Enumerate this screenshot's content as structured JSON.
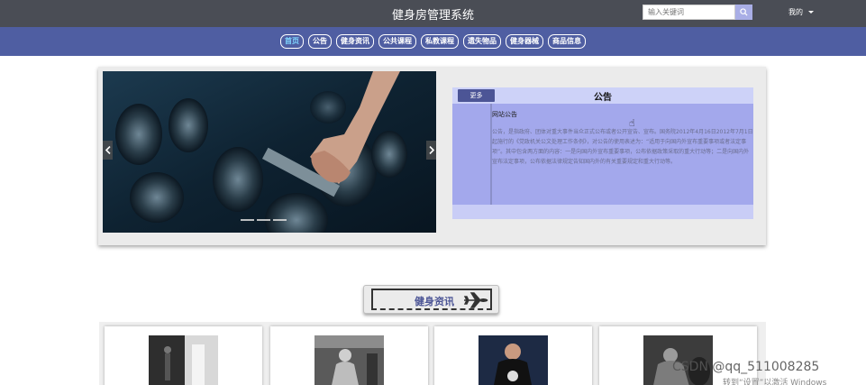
{
  "header": {
    "title": "健身房管理系统",
    "search": {
      "placeholder": "输入关键词",
      "icon": "search-icon"
    },
    "user_label": "我的"
  },
  "nav": {
    "items": [
      {
        "label": "首页",
        "active": true
      },
      {
        "label": "公告",
        "active": false
      },
      {
        "label": "健身资讯",
        "active": false
      },
      {
        "label": "公共课程",
        "active": false
      },
      {
        "label": "私教课程",
        "active": false
      },
      {
        "label": "遗失物品",
        "active": false
      },
      {
        "label": "健身器械",
        "active": false
      },
      {
        "label": "商品信息",
        "active": false
      }
    ]
  },
  "carousel": {
    "prev_icon": "chevron-left-icon",
    "next_icon": "chevron-right-icon",
    "slide_count": 3
  },
  "notice": {
    "more_label": "更多",
    "title": "公告",
    "subtitle": "网站公告",
    "body": "公告，是指政府、团体对重大事件当众正式公布或者公开宣告、宣布。国务院2012年4月16日2012年7月1日起施行的《党政机关公文处理工作条例》，对公告的使用表述为：“适用于向国内外宣布重要事项或者法定事项”。其中包含两方面的内容：一是向国内外宣布重要事项，公布依据政策采取的重大行动等；二是向国内外宣布法定事项，公布依据法律规定告知国内外的有关重要规定和重大行动等。"
  },
  "section": {
    "title": "健身资讯",
    "icon": "airplane-icon"
  },
  "watermark": {
    "text": "CSDN @qq_511008285",
    "subtext": "转到“设置”以激活 Windows"
  },
  "colors": {
    "header_bg": "#4a4d55",
    "nav_bg": "#4f5ea2",
    "accent": "#4c5596",
    "notice_bg": "#a3a8ec"
  }
}
